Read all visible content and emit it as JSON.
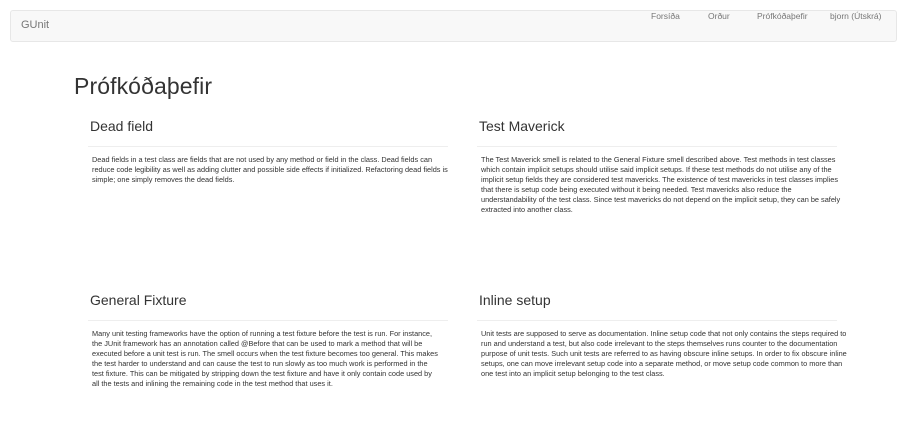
{
  "navbar": {
    "brand": "GUnit",
    "links": [
      "Forsíða",
      "Orður",
      "Prófkóðaþefir",
      "bjorn (Útskrá)"
    ]
  },
  "page": {
    "title": "Prófkóðaþefir"
  },
  "cards": [
    {
      "title": "Dead field",
      "body": "Dead fields in a test class are fields that are not used by any method or field in the class. Dead fields can reduce code legibility as well as adding clutter and possible side effects if initialized. Refactoring dead fields is simple; one simply removes the dead fields."
    },
    {
      "title": "Test Maverick",
      "body": "The Test Maverick smell is related to the General Fixture smell described above. Test methods in test classes which contain implicit setups should utilise said implicit setups. If these test methods do not utilise any of the implicit setup fields they are considered test mavericks. The existence of test mavericks in test classes implies that there is setup code being executed without it being needed. Test mavericks also reduce the understandability of the test class. Since test mavericks do not depend on the implicit setup, they can be safely extracted into another class."
    },
    {
      "title": "General Fixture",
      "body": "Many unit testing frameworks have the option of running a test fixture before the test is run. For instance, the JUnit framework has an annotation called @Before that can be used to mark a method that will be executed before a unit test is run. The smell occurs when the test fixture becomes too general. This makes the test harder to understand and can cause the test to run slowly as too much work is performed in the test fixture. This can be mitigated by stripping down the test fixture and have it only contain code used by all the tests and inlining the remaining code in the test method that uses it."
    },
    {
      "title": "Inline setup",
      "body": "Unit tests are supposed to serve as documentation. Inline setup code that not only contains the steps required to run and understand a test, but also code irrelevant to the steps themselves runs counter to the documentation purpose of unit tests. Such unit tests are referred to as having obscure inline setups. In order to fix obscure inline setups, one can move irrelevant setup code into a separate method, or move setup code common to more than one test into an implicit setup belonging to the test class."
    }
  ]
}
